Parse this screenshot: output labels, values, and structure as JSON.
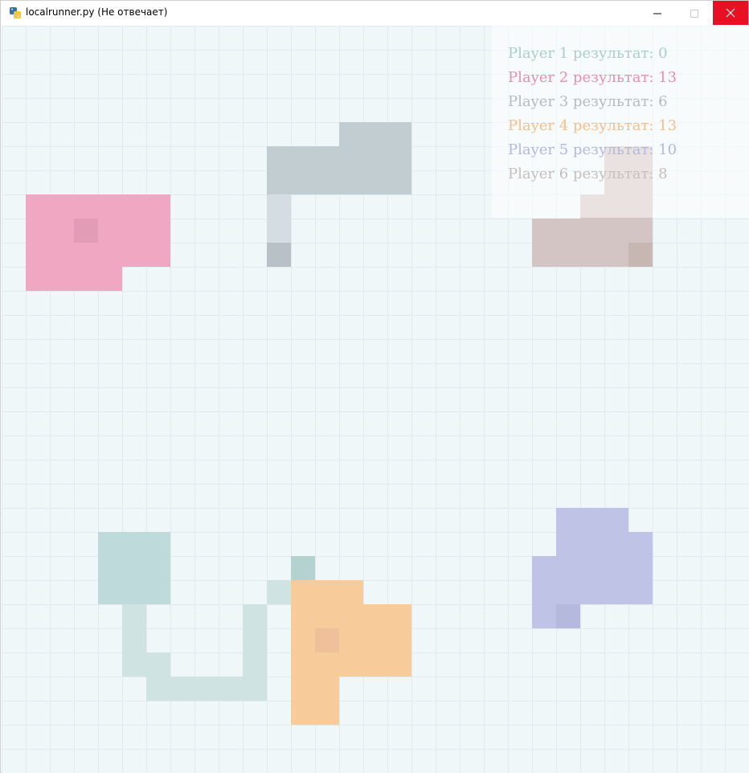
{
  "window": {
    "title": "localrunner.py (Не отвечает)",
    "close_color": "#e81123"
  },
  "board": {
    "cell_size": 30,
    "background": "#f0f7f9",
    "grid_color": "#e1ebee"
  },
  "scoreboard": {
    "lines": [
      {
        "label": "Player 1 результат: 0",
        "color": "#a8cfc8"
      },
      {
        "label": "Player 2 результат: 13",
        "color": "#e58fac"
      },
      {
        "label": "Player 3 результат: 6",
        "color": "#b3bcc2"
      },
      {
        "label": "Player 4 результат: 13",
        "color": "#f5be8c"
      },
      {
        "label": "Player 5 результат: 10",
        "color": "#b4b8df"
      },
      {
        "label": "Player 6 результат: 8",
        "color": "#c5bfbc"
      }
    ]
  },
  "players": [
    {
      "name": "player-1",
      "color": "#bedadb",
      "tail_color": "#cfe3e2",
      "head_color": "#b4d2cf",
      "territory": [
        [
          4,
          21
        ],
        [
          5,
          21
        ],
        [
          6,
          21
        ],
        [
          4,
          22
        ],
        [
          5,
          22
        ],
        [
          6,
          22
        ],
        [
          4,
          23
        ],
        [
          5,
          23
        ],
        [
          6,
          23
        ]
      ],
      "tail": [
        [
          5,
          24
        ],
        [
          5,
          25
        ],
        [
          5,
          26
        ],
        [
          6,
          26
        ],
        [
          6,
          27
        ],
        [
          7,
          27
        ],
        [
          8,
          27
        ],
        [
          9,
          27
        ],
        [
          10,
          27
        ],
        [
          10,
          26
        ],
        [
          10,
          25
        ],
        [
          10,
          24
        ],
        [
          11,
          23
        ],
        [
          12,
          23
        ]
      ],
      "head": [
        12,
        22
      ]
    },
    {
      "name": "player-2",
      "color": "#f0a8c2",
      "head_color": "#e39cb6",
      "territory": [
        [
          1,
          7
        ],
        [
          2,
          7
        ],
        [
          3,
          7
        ],
        [
          4,
          7
        ],
        [
          5,
          7
        ],
        [
          6,
          7
        ],
        [
          1,
          8
        ],
        [
          2,
          8
        ],
        [
          3,
          8
        ],
        [
          4,
          8
        ],
        [
          5,
          8
        ],
        [
          6,
          8
        ],
        [
          1,
          9
        ],
        [
          2,
          9
        ],
        [
          3,
          9
        ],
        [
          4,
          9
        ],
        [
          5,
          9
        ],
        [
          6,
          9
        ],
        [
          1,
          10
        ],
        [
          2,
          10
        ],
        [
          3,
          10
        ],
        [
          4,
          10
        ]
      ],
      "head": [
        3,
        8
      ]
    },
    {
      "name": "player-3",
      "color": "#c2cdd2",
      "tail_color": "#d4dde2",
      "head_color": "#b7c1c6",
      "territory": [
        [
          14,
          4
        ],
        [
          15,
          4
        ],
        [
          16,
          4
        ],
        [
          11,
          5
        ],
        [
          12,
          5
        ],
        [
          13,
          5
        ],
        [
          14,
          5
        ],
        [
          15,
          5
        ],
        [
          16,
          5
        ],
        [
          11,
          6
        ],
        [
          12,
          6
        ],
        [
          13,
          6
        ],
        [
          14,
          6
        ],
        [
          15,
          6
        ],
        [
          16,
          6
        ]
      ],
      "tail": [
        [
          11,
          7
        ],
        [
          11,
          8
        ]
      ],
      "head": [
        11,
        9
      ]
    },
    {
      "name": "player-4",
      "color": "#f8cb9a",
      "head_color": "#f0c09a",
      "territory": [
        [
          12,
          23
        ],
        [
          13,
          23
        ],
        [
          14,
          23
        ],
        [
          12,
          24
        ],
        [
          13,
          24
        ],
        [
          14,
          24
        ],
        [
          15,
          24
        ],
        [
          16,
          24
        ],
        [
          12,
          25
        ],
        [
          13,
          25
        ],
        [
          14,
          25
        ],
        [
          15,
          25
        ],
        [
          16,
          25
        ],
        [
          12,
          26
        ],
        [
          13,
          26
        ],
        [
          14,
          26
        ],
        [
          15,
          26
        ],
        [
          16,
          26
        ],
        [
          12,
          27
        ],
        [
          13,
          27
        ],
        [
          12,
          28
        ],
        [
          13,
          28
        ]
      ],
      "head": [
        13,
        25
      ]
    },
    {
      "name": "player-5",
      "color": "#bfc4e6",
      "head_color": "#b5b9de",
      "territory": [
        [
          23,
          20
        ],
        [
          24,
          20
        ],
        [
          25,
          20
        ],
        [
          23,
          21
        ],
        [
          24,
          21
        ],
        [
          25,
          21
        ],
        [
          26,
          21
        ],
        [
          22,
          22
        ],
        [
          23,
          22
        ],
        [
          24,
          22
        ],
        [
          25,
          22
        ],
        [
          26,
          22
        ],
        [
          22,
          23
        ],
        [
          23,
          23
        ],
        [
          24,
          23
        ],
        [
          25,
          23
        ],
        [
          26,
          23
        ],
        [
          22,
          24
        ],
        [
          23,
          24
        ]
      ],
      "head": [
        23,
        24
      ]
    },
    {
      "name": "player-6",
      "color": "#d2c5c3",
      "head_color": "#c7b7b3",
      "territory": [
        [
          25,
          5
        ],
        [
          26,
          5
        ],
        [
          25,
          6
        ],
        [
          26,
          6
        ],
        [
          24,
          7
        ],
        [
          25,
          7
        ],
        [
          26,
          7
        ],
        [
          22,
          8
        ],
        [
          23,
          8
        ],
        [
          24,
          8
        ],
        [
          25,
          8
        ],
        [
          26,
          8
        ],
        [
          22,
          9
        ],
        [
          23,
          9
        ],
        [
          24,
          9
        ],
        [
          25,
          9
        ],
        [
          26,
          9
        ]
      ],
      "head": [
        26,
        9
      ]
    }
  ]
}
